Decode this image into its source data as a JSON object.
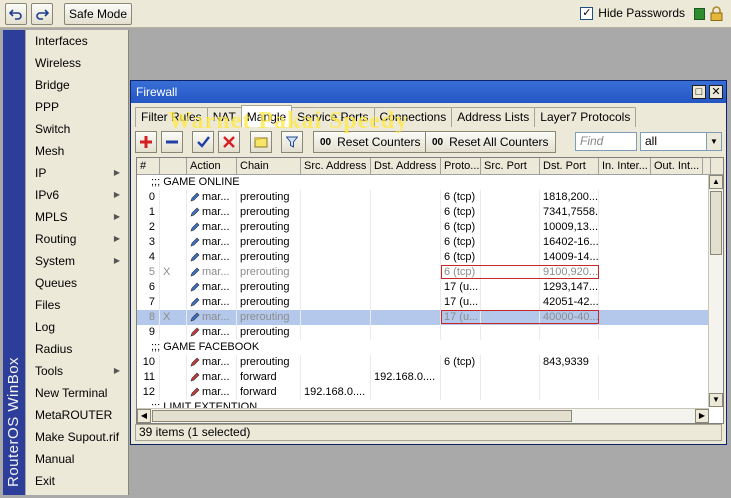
{
  "toolbar": {
    "undo_icon": "undo-arrow-icon",
    "redo_icon": "redo-arrow-icon",
    "safe_mode": "Safe Mode",
    "hide_passwords": "Hide Passwords",
    "hide_passwords_checked": true
  },
  "brand": "RouterOS WinBox",
  "sidebar": {
    "items": [
      {
        "label": "Interfaces",
        "submenu": false
      },
      {
        "label": "Wireless",
        "submenu": false
      },
      {
        "label": "Bridge",
        "submenu": false
      },
      {
        "label": "PPP",
        "submenu": false
      },
      {
        "label": "Switch",
        "submenu": false
      },
      {
        "label": "Mesh",
        "submenu": false
      },
      {
        "label": "IP",
        "submenu": true
      },
      {
        "label": "IPv6",
        "submenu": true
      },
      {
        "label": "MPLS",
        "submenu": true
      },
      {
        "label": "Routing",
        "submenu": true
      },
      {
        "label": "System",
        "submenu": true
      },
      {
        "label": "Queues",
        "submenu": false
      },
      {
        "label": "Files",
        "submenu": false
      },
      {
        "label": "Log",
        "submenu": false
      },
      {
        "label": "Radius",
        "submenu": false
      },
      {
        "label": "Tools",
        "submenu": true
      },
      {
        "label": "New Terminal",
        "submenu": false
      },
      {
        "label": "MetaROUTER",
        "submenu": false
      },
      {
        "label": "Make Supout.rif",
        "submenu": false
      },
      {
        "label": "Manual",
        "submenu": false
      },
      {
        "label": "Exit",
        "submenu": false
      }
    ]
  },
  "window": {
    "title": "Firewall",
    "tabs": [
      "Filter Rules",
      "NAT",
      "Mangle",
      "Service Ports",
      "Connections",
      "Address Lists",
      "Layer7 Protocols"
    ],
    "active_tab": "Mangle",
    "reset_counters": "Reset Counters",
    "reset_all_counters": "Reset All Counters",
    "counter_badge": "00",
    "find_placeholder": "Find",
    "filter_value": "all",
    "watermark": "Warnet Pakai Speedy",
    "status": "39 items (1 selected)"
  },
  "table": {
    "columns": [
      "#",
      "",
      "Action",
      "Chain",
      "Src. Address",
      "Dst. Address",
      "Proto...",
      "Src. Port",
      "Dst. Port",
      "In. Inter...",
      "Out. Int...",
      ""
    ],
    "rows": [
      {
        "type": "comment",
        "text": ";;; GAME ONLINE"
      },
      {
        "type": "rule",
        "num": "0",
        "flag": "",
        "action": "mar...",
        "chain": "prerouting",
        "src": "",
        "dst": "",
        "proto": "6 (tcp)",
        "sport": "",
        "dport": "1818,200...",
        "disabled": false,
        "selected": false,
        "boxed": false
      },
      {
        "type": "rule",
        "num": "1",
        "flag": "",
        "action": "mar...",
        "chain": "prerouting",
        "src": "",
        "dst": "",
        "proto": "6 (tcp)",
        "sport": "",
        "dport": "7341,7558...",
        "disabled": false,
        "selected": false,
        "boxed": false
      },
      {
        "type": "rule",
        "num": "2",
        "flag": "",
        "action": "mar...",
        "chain": "prerouting",
        "src": "",
        "dst": "",
        "proto": "6 (tcp)",
        "sport": "",
        "dport": "10009,13...",
        "disabled": false,
        "selected": false,
        "boxed": false
      },
      {
        "type": "rule",
        "num": "3",
        "flag": "",
        "action": "mar...",
        "chain": "prerouting",
        "src": "",
        "dst": "",
        "proto": "6 (tcp)",
        "sport": "",
        "dport": "16402-16...",
        "disabled": false,
        "selected": false,
        "boxed": false
      },
      {
        "type": "rule",
        "num": "4",
        "flag": "",
        "action": "mar...",
        "chain": "prerouting",
        "src": "",
        "dst": "",
        "proto": "6 (tcp)",
        "sport": "",
        "dport": "14009-14...",
        "disabled": false,
        "selected": false,
        "boxed": false
      },
      {
        "type": "rule",
        "num": "5",
        "flag": "X",
        "action": "mar...",
        "chain": "prerouting",
        "src": "",
        "dst": "",
        "proto": "6 (tcp)",
        "sport": "",
        "dport": "9100,920...",
        "disabled": true,
        "selected": false,
        "boxed": true
      },
      {
        "type": "rule",
        "num": "6",
        "flag": "",
        "action": "mar...",
        "chain": "prerouting",
        "src": "",
        "dst": "",
        "proto": "17 (u...",
        "sport": "",
        "dport": "1293,147...",
        "disabled": false,
        "selected": false,
        "boxed": false
      },
      {
        "type": "rule",
        "num": "7",
        "flag": "",
        "action": "mar...",
        "chain": "prerouting",
        "src": "",
        "dst": "",
        "proto": "17 (u...",
        "sport": "",
        "dport": "42051-42...",
        "disabled": false,
        "selected": false,
        "boxed": false
      },
      {
        "type": "rule",
        "num": "8",
        "flag": "X",
        "action": "mar...",
        "chain": "prerouting",
        "src": "",
        "dst": "",
        "proto": "17 (u...",
        "sport": "",
        "dport": "40000-40...",
        "disabled": true,
        "selected": true,
        "boxed": true
      },
      {
        "type": "rule",
        "num": "9",
        "flag": "",
        "action": "mar...",
        "chain": "prerouting",
        "src": "",
        "dst": "",
        "proto": "",
        "sport": "",
        "dport": "",
        "disabled": false,
        "selected": false,
        "boxed": false
      },
      {
        "type": "comment",
        "text": ";;; GAME FACEBOOK"
      },
      {
        "type": "rule",
        "num": "10",
        "flag": "",
        "action": "mar...",
        "chain": "prerouting",
        "src": "",
        "dst": "",
        "proto": "6 (tcp)",
        "sport": "",
        "dport": "843,9339",
        "disabled": false,
        "selected": false,
        "boxed": false
      },
      {
        "type": "rule",
        "num": "11",
        "flag": "",
        "action": "mar...",
        "chain": "forward",
        "src": "",
        "dst": "192.168.0....",
        "proto": "",
        "sport": "",
        "dport": "",
        "disabled": false,
        "selected": false,
        "boxed": false
      },
      {
        "type": "rule",
        "num": "12",
        "flag": "",
        "action": "mar...",
        "chain": "forward",
        "src": "192.168.0....",
        "dst": "",
        "proto": "",
        "sport": "",
        "dport": "",
        "disabled": false,
        "selected": false,
        "boxed": false
      },
      {
        "type": "comment",
        "text": ";;; LIMIT EXTENTION"
      }
    ]
  },
  "colors": {
    "brand_strip": "#2c3d9a",
    "titlebar": "#2456c4",
    "selected_row": "#b3c8ea",
    "highlight_box": "#c62828",
    "watermark": "#ffe94a"
  }
}
